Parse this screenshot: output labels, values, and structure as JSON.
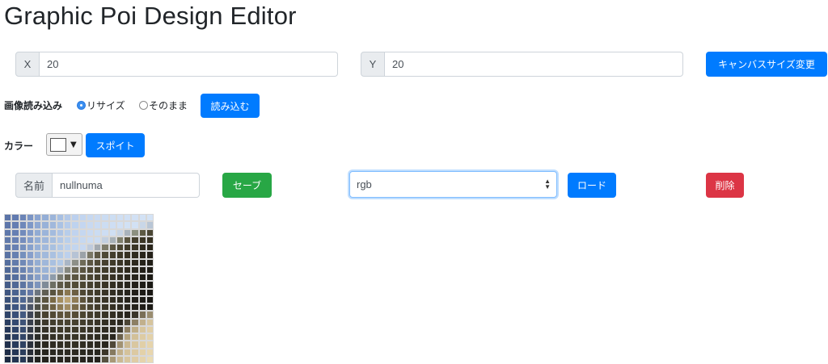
{
  "title": "Graphic Poi Design Editor",
  "canvas_size": {
    "x_label": "X",
    "x_value": "20",
    "y_label": "Y",
    "y_value": "20",
    "change_button": "キャンバスサイズ変更"
  },
  "image_load": {
    "label": "画像読み込み",
    "options": [
      "リサイズ",
      "そのまま"
    ],
    "selected": "リサイズ",
    "load_button": "読み込む"
  },
  "color": {
    "label": "カラー",
    "current": "#ffffff",
    "eyedropper_button": "スポイト"
  },
  "save_load": {
    "name_label": "名前",
    "name_value": "nullnuma",
    "save_button": "セーブ",
    "select_value": "rgb",
    "load_button": "ロード",
    "delete_button": "削除"
  },
  "accent_colors": {
    "primary": "#007bff",
    "success": "#28a745",
    "danger": "#dc3545"
  },
  "pixel_grid": {
    "columns": 20,
    "rows": 20,
    "pixels": [
      [
        "#5b74a8",
        "#627bb0",
        "#6b84b7",
        "#7a94c4",
        "#8aa4d0",
        "#94aed6",
        "#9cb5da",
        "#a7bfe2",
        "#b2c8e8",
        "#bcd0ee",
        "#c2d5f0",
        "#c6d8f1",
        "#c9daf2",
        "#cbdcf2",
        "#cddef3",
        "#cfdff3",
        "#d0e0f4",
        "#d2e1f4",
        "#d3e2f5",
        "#d4e3f5"
      ],
      [
        "#5d76aa",
        "#647db2",
        "#6f88ba",
        "#7e98c7",
        "#8ea8d2",
        "#98b1d8",
        "#a0b8dc",
        "#aac2e4",
        "#b5cbea",
        "#bed2ee",
        "#c4d6f0",
        "#c8d9f1",
        "#cadbf2",
        "#ccddf2",
        "#cedef3",
        "#d0e0f4",
        "#d1e1f4",
        "#d2e1f4",
        "#c9d7e8",
        "#b9c6d6"
      ],
      [
        "#5f78ab",
        "#677fb3",
        "#728bbc",
        "#819bc9",
        "#91abd3",
        "#9bb4da",
        "#a3bbde",
        "#adc4e5",
        "#b7cdea",
        "#c0d3ef",
        "#c5d7f0",
        "#c9daf2",
        "#cbdcf2",
        "#cdddf3",
        "#cfdff3",
        "#c6d4e5",
        "#a9b3bc",
        "#8c9080",
        "#5d5a44",
        "#4a4634"
      ],
      [
        "#6079aa",
        "#6981b4",
        "#758dbd",
        "#849ecb",
        "#94aed5",
        "#9eb6db",
        "#a6bedf",
        "#b0c7e6",
        "#b9cfeb",
        "#c1d4ef",
        "#c6d8f0",
        "#cadbf2",
        "#cbdcf2",
        "#c2cfe0",
        "#a7b0b6",
        "#7f7f6c",
        "#5a5540",
        "#433e2c",
        "#3b3626",
        "#353022"
      ],
      [
        "#5e77a8",
        "#6880b2",
        "#7690be",
        "#86a0cc",
        "#97b0d6",
        "#a0b8dc",
        "#a8c0e0",
        "#b2c9e7",
        "#bbd0ec",
        "#c2d5ef",
        "#c7d8f1",
        "#bfcbdc",
        "#a3aab0",
        "#7d7b69",
        "#5b5642",
        "#4a4532",
        "#403b2a",
        "#3a3525",
        "#2f2b1f",
        "#2a261b"
      ],
      [
        "#5a73a4",
        "#6680b1",
        "#7590bd",
        "#879fcb",
        "#98b1d6",
        "#a1b9dc",
        "#aac1e1",
        "#b3cae7",
        "#bcd0ec",
        "#b6c3d5",
        "#9ba2a8",
        "#7a7765",
        "#5f5945",
        "#4d4835",
        "#433e2d",
        "#3d3828",
        "#363123",
        "#2f2b1f",
        "#29251b",
        "#252119"
      ],
      [
        "#556e9e",
        "#627bab",
        "#7089b7",
        "#839bc6",
        "#94add2",
        "#9fb7da",
        "#a9c0e0",
        "#b2c9e6",
        "#a9b6c6",
        "#8d8f88",
        "#6f6b58",
        "#5c5643",
        "#504a37",
        "#47412f",
        "#403b2a",
        "#3a3526",
        "#332f21",
        "#2c281d",
        "#26231a",
        "#211e16"
      ],
      [
        "#4f6897",
        "#5b74a4",
        "#6982b0",
        "#7b94bf",
        "#8ea7cd",
        "#9ab3d7",
        "#a5bcde",
        "#9eabbb",
        "#868880",
        "#6c6755",
        "#5a5441",
        "#4f4936",
        "#47422f",
        "#413c2b",
        "#3b3627",
        "#353123",
        "#2f2b1f",
        "#29261c",
        "#232019",
        "#1e1b15"
      ],
      [
        "#4a6290",
        "#556e9d",
        "#637ba9",
        "#748db8",
        "#879fc7",
        "#92a9cf",
        "#8e9cab",
        "#7a7c72",
        "#65604e",
        "#5a5441",
        "#524c39",
        "#4a4532",
        "#433e2d",
        "#3d3829",
        "#373225",
        "#312d21",
        "#2b281e",
        "#26231b",
        "#201e18",
        "#1c1a15"
      ],
      [
        "#445c88",
        "#506896",
        "#5d75a2",
        "#6d85b0",
        "#7d94bc",
        "#7f8b98",
        "#6d6e63",
        "#5e5948",
        "#57513e",
        "#514b38",
        "#4b4633",
        "#45402f",
        "#3f3a2a",
        "#393427",
        "#332f23",
        "#2e2a20",
        "#28251d",
        "#23201a",
        "#1e1c17",
        "#1a1814"
      ],
      [
        "#3f5680",
        "#4a628f",
        "#56709c",
        "#6478a5",
        "#6c7580",
        "#5f5e53",
        "#58533f",
        "#6e6040",
        "#8a7750",
        "#6c5e42",
        "#4e4733",
        "#46402e",
        "#3f3a2a",
        "#383326",
        "#322e23",
        "#2c291f",
        "#27241c",
        "#221f19",
        "#1d1b16",
        "#191713"
      ],
      [
        "#3a5179",
        "#445c88",
        "#4f6792",
        "#59657a",
        "#585a50",
        "#5a543f",
        "#7a6a45",
        "#a48e60",
        "#bba373",
        "#8f7b55",
        "#5d533b",
        "#484230",
        "#403b2b",
        "#393427",
        "#332f24",
        "#2d2a20",
        "#28251d",
        "#23201a",
        "#1e1c17",
        "#1a1814"
      ],
      [
        "#344a71",
        "#3e5580",
        "#495f89",
        "#4c5566",
        "#4e4f47",
        "#5a5441",
        "#6f6244",
        "#8c7a54",
        "#a08b62",
        "#7c6c4b",
        "#594f38",
        "#4a4431",
        "#423c2c",
        "#3b3628",
        "#353024",
        "#2f2b21",
        "#2a261e",
        "#25221b",
        "#201d18",
        "#1c1a15"
      ],
      [
        "#2f4469",
        "#394f78",
        "#435980",
        "#3f4656",
        "#404037",
        "#484231",
        "#524a35",
        "#5d533b",
        "#60563d",
        "#554c36",
        "#4c4632",
        "#453f2e",
        "#3e392a",
        "#383326",
        "#322e23",
        "#2c2920",
        "#27241d",
        "#3a352a",
        "#7a6f58",
        "#9a8d70"
      ],
      [
        "#2a3e61",
        "#344970",
        "#3d5277",
        "#383f4c",
        "#363731",
        "#3c382b",
        "#423d2d",
        "#48422f",
        "#4a4431",
        "#47412f",
        "#433d2c",
        "#3e392a",
        "#393427",
        "#343024",
        "#2f2b21",
        "#2a271e",
        "#4b4535",
        "#8c7f64",
        "#c1b08c",
        "#d6c49d"
      ],
      [
        "#26385a",
        "#2f4368",
        "#384c70",
        "#343b47",
        "#31322d",
        "#353228",
        "#3a3629",
        "#3f3a2a",
        "#413c2b",
        "#3f3a2a",
        "#3c3728",
        "#383326",
        "#343024",
        "#302c22",
        "#2c291f",
        "#3f3a2e",
        "#8d7f62",
        "#bfae88",
        "#d7c59d",
        "#e0cea6"
      ],
      [
        "#233452",
        "#2b3e60",
        "#334668",
        "#2f3541",
        "#2c2d29",
        "#302d24",
        "#343126",
        "#383426",
        "#3a3628",
        "#393527",
        "#363225",
        "#332f23",
        "#2f2c21",
        "#2c291f",
        "#2a271f",
        "#6a604b",
        "#b5a47f",
        "#d2c098",
        "#ddcba3",
        "#e3d1a9"
      ],
      [
        "#20304c",
        "#283a5a",
        "#2f4262",
        "#2b313c",
        "#282925",
        "#2b2820",
        "#2e2b22",
        "#312e23",
        "#333024",
        "#322f23",
        "#302d22",
        "#2e2b21",
        "#2b281f",
        "#29261e",
        "#4f4838",
        "#a19272",
        "#cbb992",
        "#d9c7a0",
        "#e1cfa7",
        "#e6d4ac"
      ],
      [
        "#1e2d47",
        "#253655",
        "#2b3d5c",
        "#282d37",
        "#252622",
        "#27251e",
        "#2a2820",
        "#2c2a21",
        "#2e2b22",
        "#2d2a21",
        "#2b2920",
        "#2a271f",
        "#28261e",
        "#3a3529",
        "#867a60",
        "#c2b08b",
        "#d4c29b",
        "#dcc9a2",
        "#e3d1a9",
        "#e8d6ae"
      ],
      [
        "#1c2a42",
        "#223350",
        "#283956",
        "#252a33",
        "#222320",
        "#24221c",
        "#26241e",
        "#28261f",
        "#2a2720",
        "#29271f",
        "#28251f",
        "#26241e",
        "#25231d",
        "#55503f",
        "#a89876",
        "#cbb993",
        "#d7c59e",
        "#dfcca5",
        "#e5d3ab",
        "#eadbb3"
      ]
    ]
  }
}
